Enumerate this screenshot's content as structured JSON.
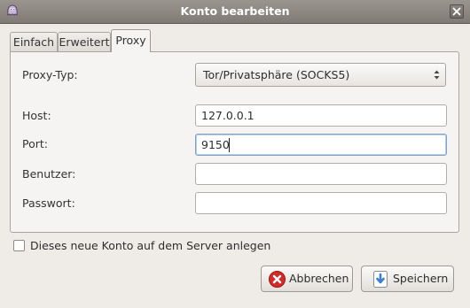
{
  "window": {
    "title": "Konto bearbeiten"
  },
  "tabs": [
    {
      "label": "Einfach",
      "active": false
    },
    {
      "label": "Erweitert",
      "active": false
    },
    {
      "label": "Proxy",
      "active": true
    }
  ],
  "proxy": {
    "type_label": "Proxy-Typ:",
    "type_value": "Tor/Privatsphäre (SOCKS5)",
    "host_label": "Host:",
    "host_value": "127.0.0.1",
    "port_label": "Port:",
    "port_value": "9150",
    "user_label": "Benutzer:",
    "user_value": "",
    "password_label": "Passwort:",
    "password_value": ""
  },
  "create_account": {
    "label": "Dieses neue Konto auf dem Server anlegen",
    "checked": false
  },
  "buttons": {
    "cancel_label": "Abbrechen",
    "save_label": "Speichern"
  },
  "colors": {
    "titlebar": "#8a857f",
    "cancel_icon": "#d42a2a",
    "save_icon": "#3b7fd0"
  },
  "icons": {
    "app": "pidgin-icon",
    "close": "close-icon",
    "cancel": "cancel-icon",
    "save": "save-icon"
  }
}
